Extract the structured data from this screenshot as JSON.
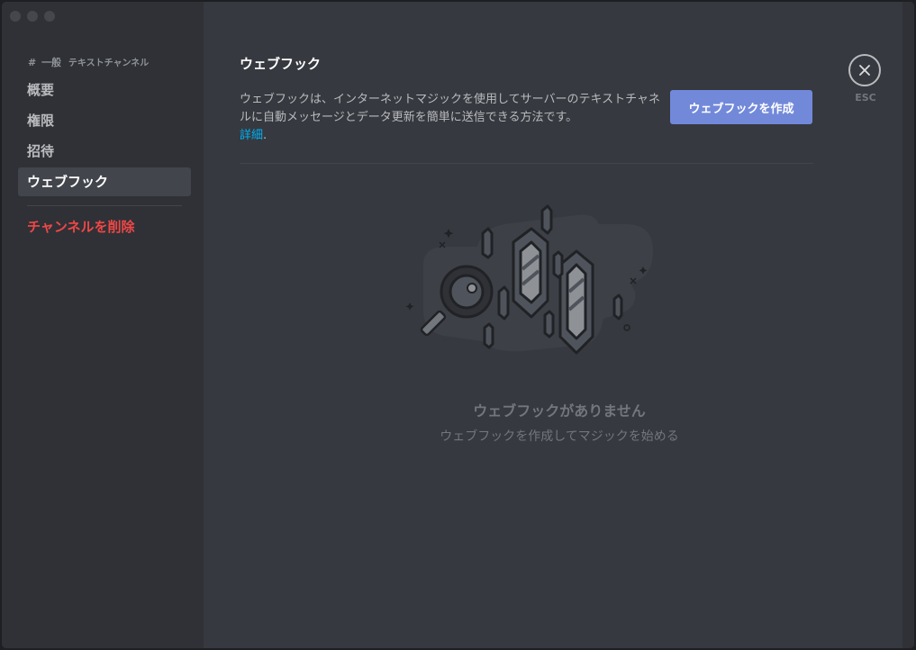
{
  "sidebar": {
    "header": {
      "hash": "#",
      "channel": "一般",
      "type": "テキストチャンネル"
    },
    "items": [
      {
        "label": "概要"
      },
      {
        "label": "権限"
      },
      {
        "label": "招待"
      },
      {
        "label": "ウェブフック"
      }
    ],
    "delete_label": "チャンネルを削除"
  },
  "main": {
    "title": "ウェブフック",
    "description": "ウェブフックは、インターネットマジックを使用してサーバーのテキストチャネルに自動メッセージとデータ更新を簡単に送信できる方法です。",
    "learn_more": "詳細",
    "create_button": "ウェブフックを作成",
    "close_label": "ESC",
    "empty_title": "ウェブフックがありません",
    "empty_subtitle": "ウェブフックを作成してマジックを始める"
  },
  "colors": {
    "accent": "#7289da",
    "danger": "#f04747",
    "link": "#00b0f4"
  }
}
